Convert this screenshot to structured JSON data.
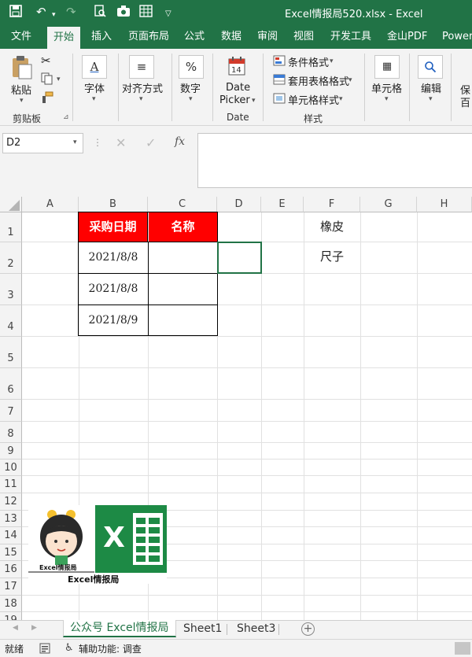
{
  "window": {
    "title": "Excel情报局520.xlsx  -  Excel"
  },
  "tabs": [
    "文件",
    "开始",
    "插入",
    "页面布局",
    "公式",
    "数据",
    "审阅",
    "视图",
    "开发工具",
    "金山PDF",
    "Power"
  ],
  "ribbon": {
    "clipboard": {
      "paste": "粘贴",
      "label": "剪贴板"
    },
    "font": {
      "label": "字体"
    },
    "alignment": {
      "label": "对齐方式"
    },
    "number": {
      "label": "数字"
    },
    "date": {
      "button_line1": "Date",
      "button_line2": "Picker",
      "label": "Date",
      "icon_num": "14"
    },
    "styles": {
      "conditional": "条件格式",
      "table": "套用表格格式",
      "cell": "单元格样式",
      "label": "样式"
    },
    "cells": {
      "label": "单元格"
    },
    "edit": {
      "label": "编辑"
    },
    "extra": {
      "line1": "保",
      "line2": "百"
    }
  },
  "formula_bar": {
    "name_box": "D2",
    "fx": "fx",
    "content": ""
  },
  "columns": [
    "A",
    "B",
    "C",
    "D",
    "E",
    "F",
    "G",
    "H"
  ],
  "rows": [
    "1",
    "2",
    "3",
    "4",
    "5",
    "6",
    "7",
    "8",
    "9",
    "10",
    "11",
    "12",
    "13",
    "14",
    "15",
    "16",
    "17",
    "18",
    "19"
  ],
  "table": {
    "headers": [
      "采购日期",
      "名称"
    ],
    "rows": [
      [
        "2021/8/8",
        ""
      ],
      [
        "2021/8/8",
        ""
      ],
      [
        "2021/8/9",
        ""
      ]
    ],
    "header_bg": "#ff0000"
  },
  "f_column": [
    "橡皮",
    "尺子"
  ],
  "logo": {
    "caption1": "Excel情报局",
    "caption2": "Excel情报局",
    "mark": "X"
  },
  "sheets": [
    "公众号 Excel情报局",
    "Sheet1",
    "Sheet3"
  ],
  "status": {
    "ready": "就绪",
    "accessibility": "辅助功能: 调查"
  },
  "colors": {
    "accent": "#217346"
  }
}
